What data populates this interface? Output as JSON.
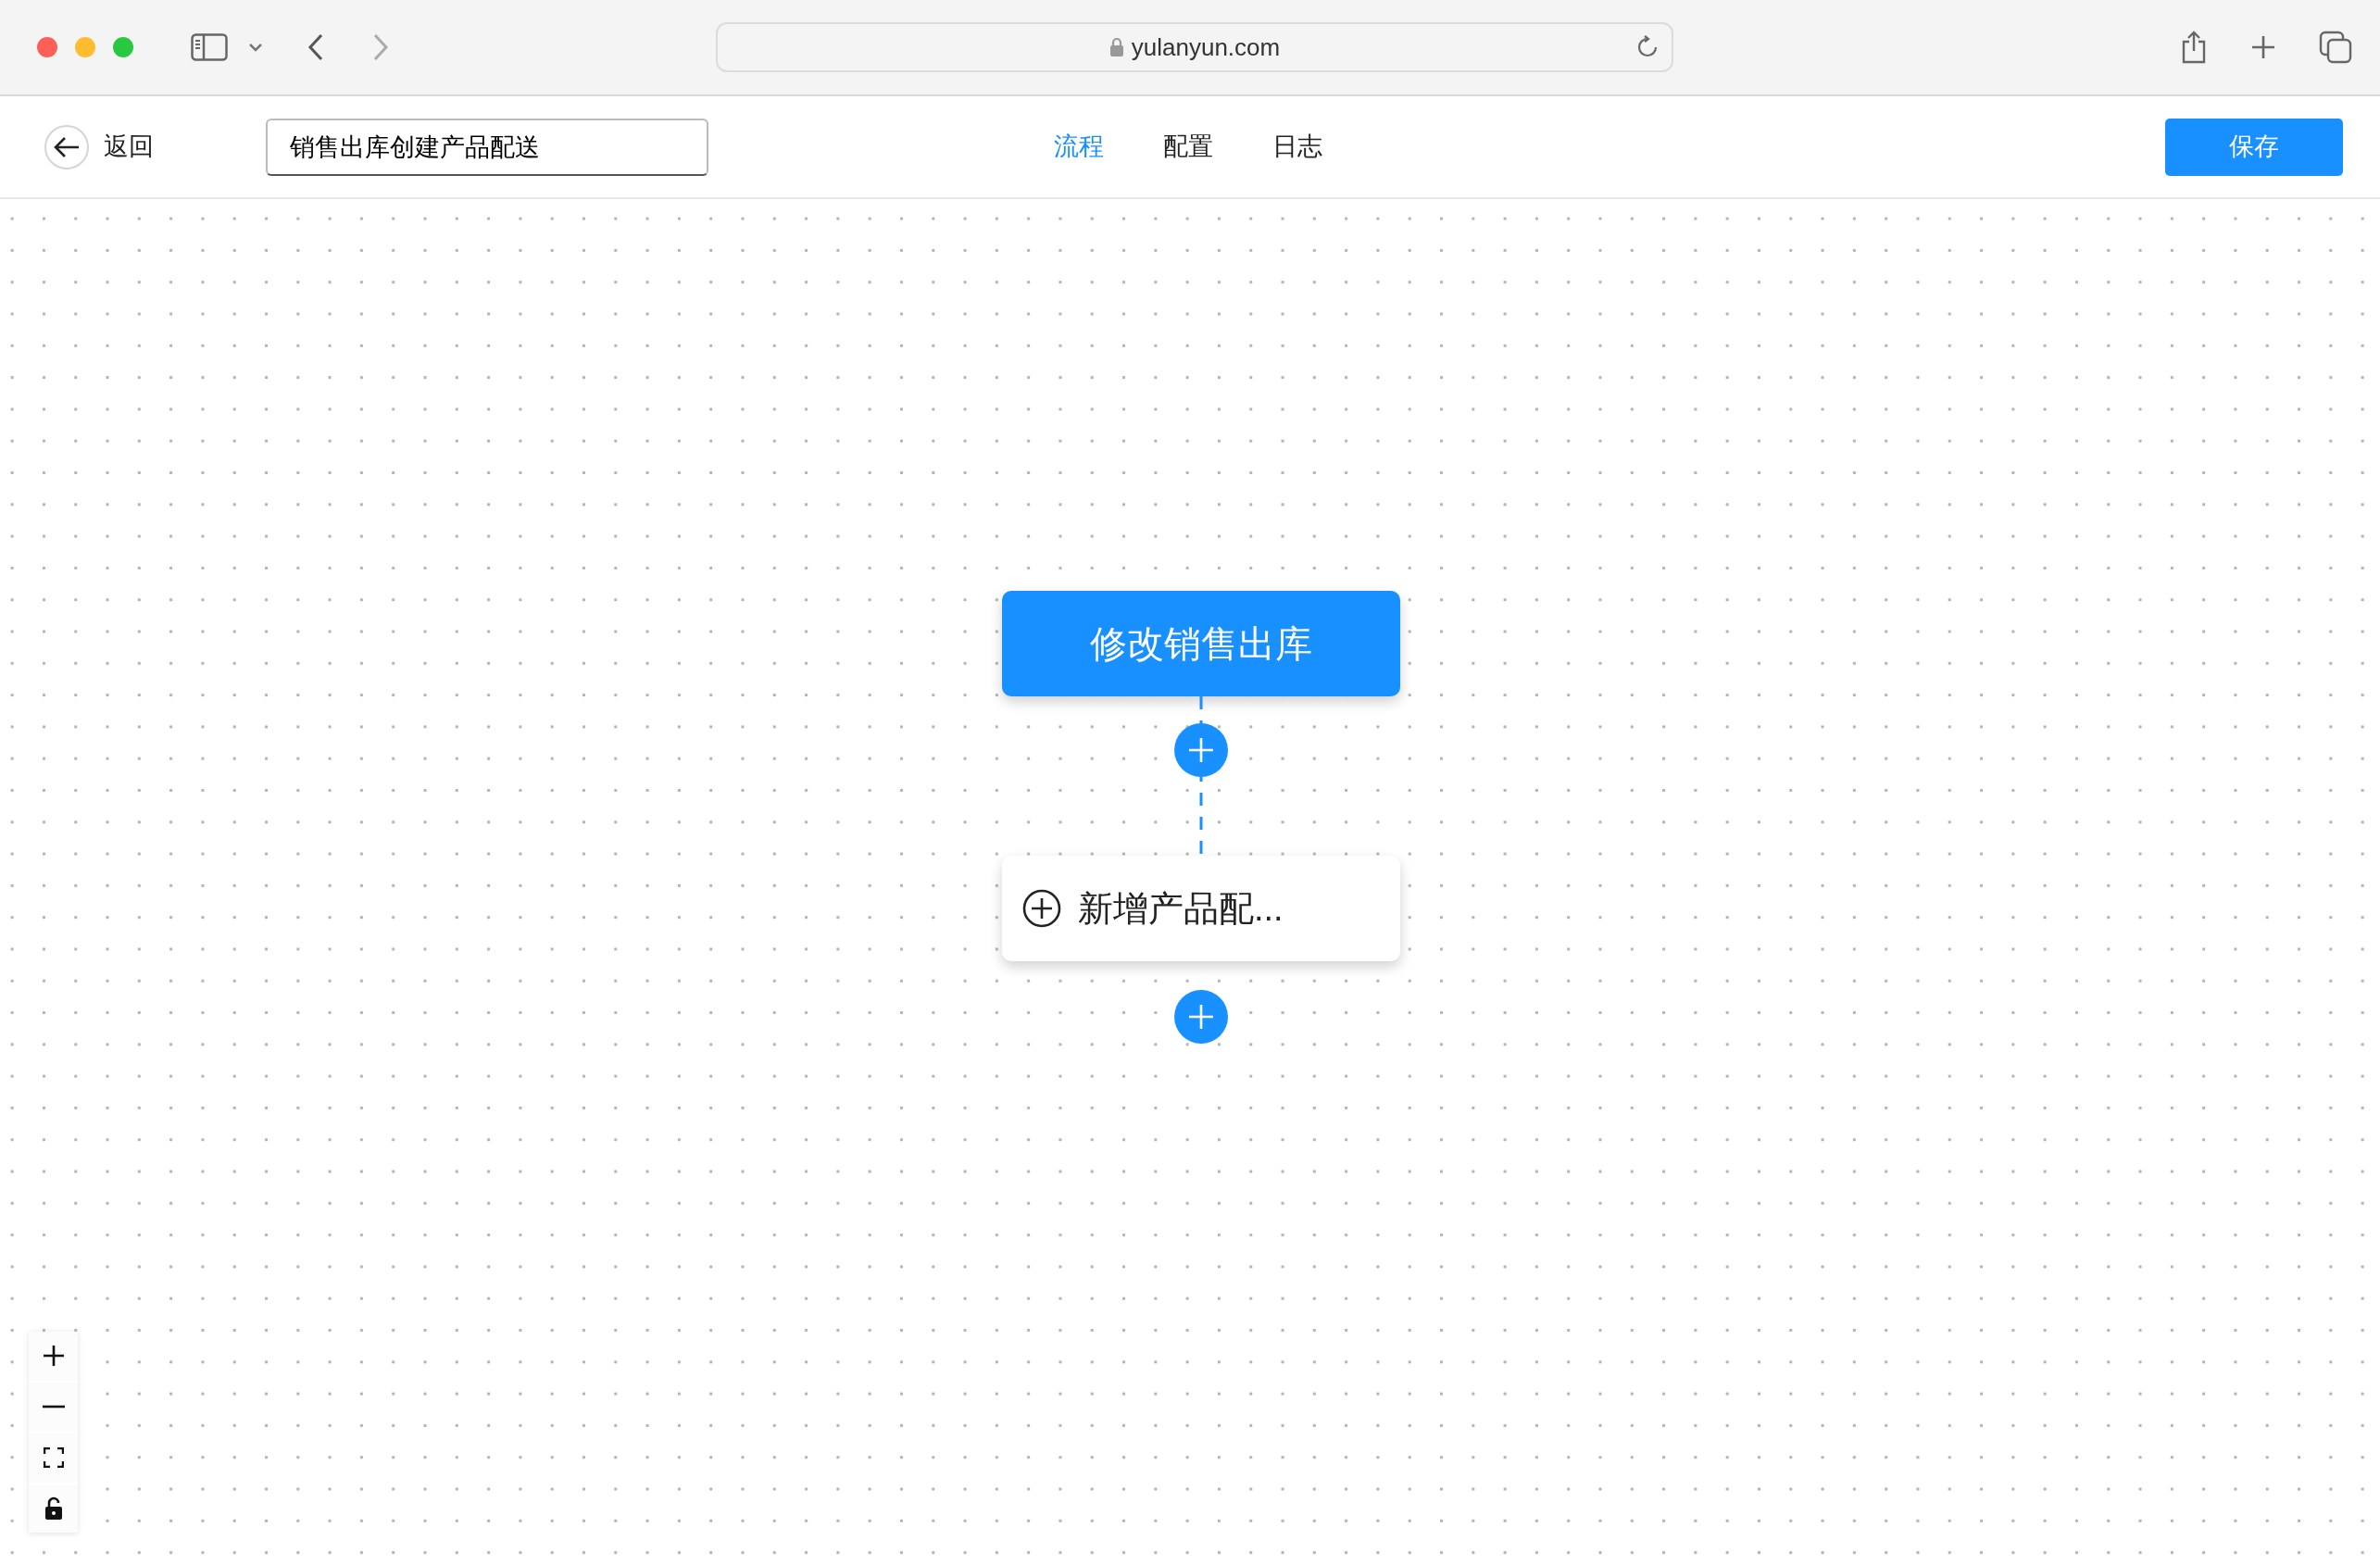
{
  "browser": {
    "url": "yulanyun.com"
  },
  "header": {
    "back_label": "返回",
    "title_value": "销售出库创建产品配送",
    "tabs": [
      {
        "label": "流程",
        "selected": true
      },
      {
        "label": "配置",
        "selected": false
      },
      {
        "label": "日志",
        "selected": false
      }
    ],
    "save_label": "保存"
  },
  "flow": {
    "nodes": [
      {
        "kind": "trigger",
        "label": "修改销售出库"
      },
      {
        "kind": "action",
        "label": "新增产品配..."
      }
    ]
  }
}
